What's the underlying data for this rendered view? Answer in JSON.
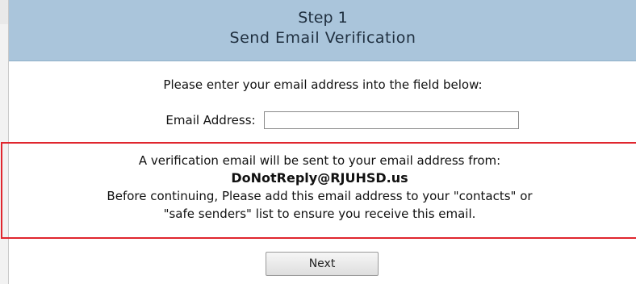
{
  "header": {
    "step": "Step 1",
    "title": "Send Email Verification"
  },
  "intro": "Please enter your email address into the field below:",
  "form": {
    "email_label": "Email Address:",
    "email_value": "",
    "email_placeholder": ""
  },
  "notice": {
    "line1": "A verification email will be sent to your email address from:",
    "sender": "DoNotReply@RJUHSD.us",
    "line3": "Before continuing, Please add this email address to your \"contacts\" or",
    "line4": "\"safe senders\" list to ensure you receive this email.",
    "border_color": "#e0262e"
  },
  "actions": {
    "next_label": "Next"
  },
  "colors": {
    "header_bg": "#aac5db"
  }
}
